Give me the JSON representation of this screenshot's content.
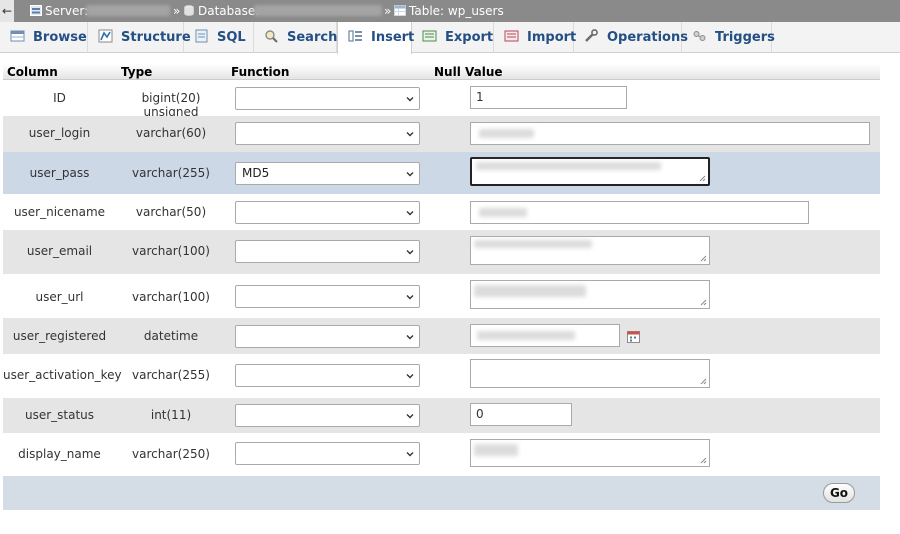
{
  "breadcrumb": {
    "server_label": "Server:",
    "database_label": "Database:",
    "table_label": "Table: wp_users",
    "separator": "»"
  },
  "tabs": [
    {
      "label": "Browse",
      "icon": "browse-icon"
    },
    {
      "label": "Structure",
      "icon": "structure-icon"
    },
    {
      "label": "SQL",
      "icon": "sql-icon"
    },
    {
      "label": "Search",
      "icon": "search-icon"
    },
    {
      "label": "Insert",
      "icon": "insert-icon",
      "active": true
    },
    {
      "label": "Export",
      "icon": "export-icon"
    },
    {
      "label": "Import",
      "icon": "import-icon"
    },
    {
      "label": "Operations",
      "icon": "operations-icon"
    },
    {
      "label": "Triggers",
      "icon": "triggers-icon"
    }
  ],
  "headers": {
    "column": "Column",
    "type": "Type",
    "function": "Function",
    "null": "Null",
    "value": "Value"
  },
  "rows": [
    {
      "column": "ID",
      "type": "bigint(20) unsigned",
      "function": "",
      "value": "1"
    },
    {
      "column": "user_login",
      "type": "varchar(60)",
      "function": "",
      "value": ""
    },
    {
      "column": "user_pass",
      "type": "varchar(255)",
      "function": "MD5",
      "value": ""
    },
    {
      "column": "user_nicename",
      "type": "varchar(50)",
      "function": "",
      "value": ""
    },
    {
      "column": "user_email",
      "type": "varchar(100)",
      "function": "",
      "value": ""
    },
    {
      "column": "user_url",
      "type": "varchar(100)",
      "function": "",
      "value": ""
    },
    {
      "column": "user_registered",
      "type": "datetime",
      "function": "",
      "value": ""
    },
    {
      "column": "user_activation_key",
      "type": "varchar(255)",
      "function": "",
      "value": ""
    },
    {
      "column": "user_status",
      "type": "int(11)",
      "function": "",
      "value": "0"
    },
    {
      "column": "display_name",
      "type": "varchar(250)",
      "function": "",
      "value": ""
    }
  ],
  "go_label": "Go",
  "colors": {
    "tab_text": "#234f84",
    "marked_row": "#ccd8e6",
    "even_row": "#e5e5e5",
    "breadcrumb_bg": "#8a8a8a"
  }
}
